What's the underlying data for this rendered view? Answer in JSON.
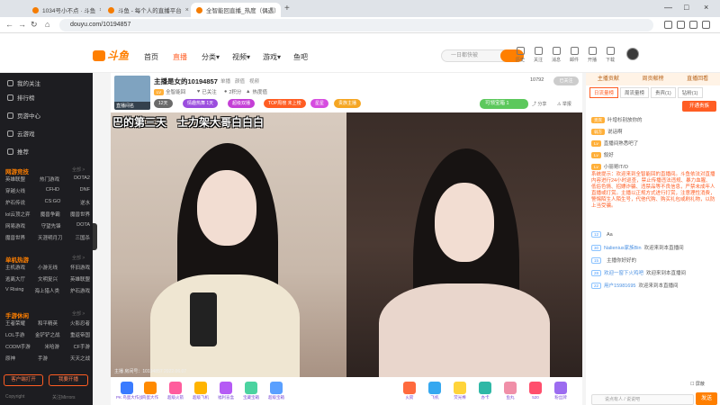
{
  "browser": {
    "tabs": [
      {
        "label": "1034号小不点 · 斗鱼",
        "active": false
      },
      {
        "label": "斗鱼 - 每个人的直播平台",
        "active": false
      },
      {
        "label": "全智能回直播_热度（偶遇）",
        "active": true
      }
    ],
    "url": "douyu.com/10194857"
  },
  "header": {
    "logo": "斗鱼",
    "nav": [
      "首页",
      "直播",
      "分类▾",
      "视频▾",
      "游戏▾",
      "鱼吧"
    ],
    "search_placeholder": "一日都快被",
    "icons": [
      {
        "icon": "history-icon",
        "label": "历史"
      },
      {
        "icon": "follow-icon",
        "label": "关注"
      },
      {
        "icon": "message-icon",
        "label": "消息"
      },
      {
        "icon": "mail-icon",
        "label": "邮件"
      },
      {
        "icon": "broadcast-icon",
        "label": "开播"
      },
      {
        "icon": "download-icon",
        "label": "下载"
      }
    ]
  },
  "sidebar": {
    "items": [
      {
        "icon": "heart-icon",
        "label": "我的关注"
      },
      {
        "icon": "rank-icon",
        "label": "排行榜"
      },
      {
        "icon": "video-icon",
        "label": "页游中心"
      },
      {
        "icon": "game-icon",
        "label": "云游戏"
      },
      {
        "icon": "grid-icon",
        "label": "推荐"
      }
    ],
    "sections": [
      {
        "title": "网游竞技",
        "rows": [
          [
            "英雄联盟",
            "热门游戏",
            "DOTA2"
          ],
          [
            "穿越火线",
            "CFHD",
            "DNF"
          ],
          [
            "炉石传说",
            "CS:GO",
            "逆水"
          ],
          [
            "lol云顶之弈",
            "魔兽争霸",
            "魔兽世界"
          ],
          [
            "网易游戏",
            "守望先锋",
            "DOTA"
          ],
          [
            "魔兽世界",
            "天涯明月刀",
            "三国杀"
          ]
        ]
      },
      {
        "title": "单机热游",
        "rows": [
          [
            "主机游戏",
            "小游无线",
            "怀旧游戏"
          ],
          [
            "逃离大厅",
            "文明复兴",
            "英雄联盟"
          ],
          [
            "V Rising",
            "海上猎人类",
            "炉石游戏"
          ]
        ]
      },
      {
        "title": "手游休闲",
        "rows": [
          [
            "王者荣耀",
            "和平精英",
            "火影忍者"
          ],
          [
            "LOL手游",
            "金铲铲之战",
            "重返帝国"
          ],
          [
            "CODM手游",
            "米哈游",
            "CF手游"
          ],
          [
            "原神",
            "手游",
            "天天之战"
          ]
        ]
      }
    ],
    "buttons": [
      "客户端打开",
      "我要开播"
    ],
    "footer": [
      "Copyright",
      "关注Mirrors"
    ],
    "more": "全部 >"
  },
  "room": {
    "title": "主播是女的10194857",
    "tags": [
      "单播",
      "颜值",
      "视频"
    ],
    "meta": [
      "全智能回",
      "已关注",
      "2积分",
      "热度值"
    ],
    "pills": [
      {
        "text": "12天",
        "color": "#6a6a6a"
      },
      {
        "text": "情趣热舞 1天",
        "color": "#9b4dde"
      },
      {
        "text": "超级双播",
        "color": "#c43fd6"
      },
      {
        "text": "TOP周榜 未上榜",
        "color": "#ff5d23"
      },
      {
        "text": "星星",
        "color": "#d64ce0"
      },
      {
        "text": "贵族主播",
        "color": "#f5a623"
      }
    ],
    "viewers": "10792",
    "follow_btn": "已关注",
    "treasure": "可领宝箱",
    "treasure_count": "1",
    "share": "分享",
    "report": "举报",
    "thumb_caption": "直播间名",
    "video_overlay_left": "巴的第三天",
    "video_overlay_right": "士力架大哥白白白",
    "video_stamp": "主播 房间号：10194857  2022.06.07"
  },
  "gifts": [
    {
      "label": "PK 鸟蛋大作战",
      "color": "#3a7bff"
    },
    {
      "label": "鸟蛋大作",
      "color": "#ff8a00"
    },
    {
      "label": "超级火箭",
      "color": "#ff5d9d"
    },
    {
      "label": "超级飞机",
      "color": "#ffb400"
    },
    {
      "label": "福利盲盒",
      "color": "#b55bf5"
    },
    {
      "label": "宝藏宝箱",
      "color": "#4bd3a0"
    },
    {
      "label": "超级宝箱",
      "color": "#5aa0ff"
    },
    {
      "label": "火箭",
      "color": "#ff6a3d"
    },
    {
      "label": "飞机",
      "color": "#36a8f0"
    },
    {
      "label": "荧光棒",
      "color": "#ffd43a"
    },
    {
      "label": "办卡",
      "color": "#2fb8a6"
    },
    {
      "label": "鱼丸",
      "color": "#f08fa8"
    },
    {
      "label": "520",
      "color": "#ff4f6d"
    },
    {
      "label": "粉丝牌",
      "color": "#9c6cf0"
    }
  ],
  "chat": {
    "tabs": [
      "主播贡献",
      "周贡献榜",
      "直播回看"
    ],
    "subtabs": [
      "日流量榜",
      "周流量榜",
      "贵宾(1)",
      "钻粉(1)"
    ],
    "open_btn": "开通贵族",
    "lines": [
      {
        "badge": "贵宾",
        "text": "叶增杉别放你的"
      },
      {
        "badge": "弱方",
        "text": "说话啊"
      },
      {
        "badge": "",
        "text": "直播间熟悉吧了"
      },
      {
        "badge": "",
        "text": "叙好"
      },
      {
        "badge": "",
        "text": "小丽哥IT/O"
      }
    ],
    "system": "系统提示：欢迎来到全智能回的直播间。斗鱼依法对直播内容进行24小时巡查，禁止传播违法违规、暴力血腥、低俗色情、招嫖诈骗、违禁品等不良信息，严禁未成年人直播或打赏。主播以正规方式进行打赏，注意理性消费，警惕陌生人陌生号，代他代购、购买礼包或刷礼物，以防上当受骗。",
    "messages": [
      {
        "lv": "12",
        "user": "",
        "text": "Aa​​"
      },
      {
        "lv": "30",
        "user": "Nalienius家族Bin",
        "text": "欢迎来到本直播间"
      },
      {
        "lv": "15",
        "user": "",
        "text": "主播你好好的"
      },
      {
        "lv": "28",
        "user": "欢迎一窗下火鸡吧",
        "text": "欢迎来到本直播间"
      },
      {
        "lv": "22",
        "user": "用户15981695",
        "text": "欢迎来到本直播间"
      }
    ],
    "shield": "屏蔽",
    "input_placeholder": "说点有人 / 说说吧",
    "send": "发送"
  }
}
